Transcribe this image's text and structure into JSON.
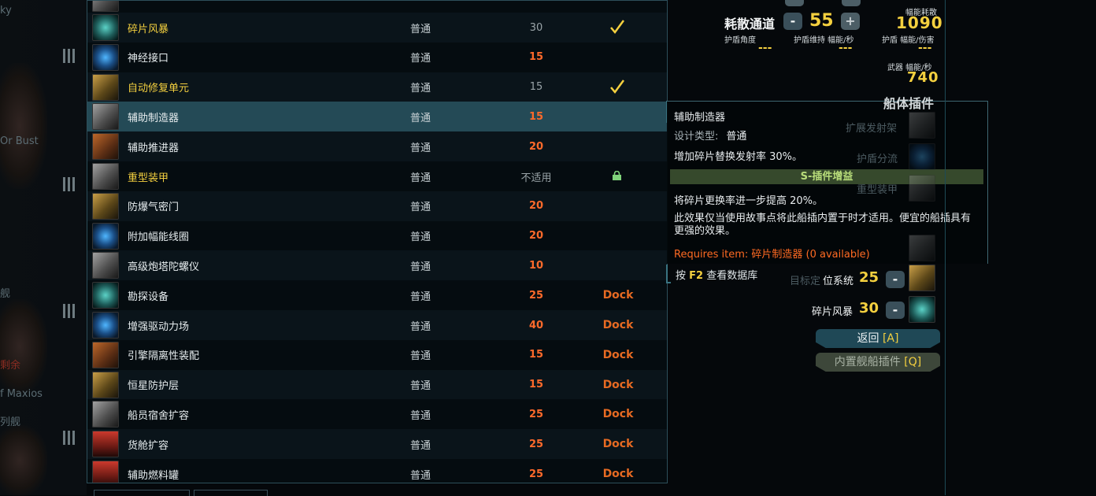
{
  "left_strip": {
    "frag1": "ky",
    "frag2": "Or Bust",
    "frag3": "舰",
    "frag4": "剩余",
    "frag5": "f Maxios",
    "frag6": "列舰"
  },
  "list": {
    "rows": [
      {
        "name": "碎片风暴",
        "type": "普通",
        "cost": "30",
        "status": "check",
        "highlight": true,
        "cost_style": "muted",
        "icon": "teal"
      },
      {
        "name": "神经接口",
        "type": "普通",
        "cost": "15",
        "status": "",
        "highlight": false,
        "cost_style": "orange",
        "icon": "blue"
      },
      {
        "name": "自动修复单元",
        "type": "普通",
        "cost": "15",
        "status": "check",
        "highlight": true,
        "cost_style": "muted",
        "icon": "gold"
      },
      {
        "name": "辅助制造器",
        "type": "普通",
        "cost": "15",
        "status": "",
        "highlight": false,
        "cost_style": "orange",
        "icon": "grey",
        "selected": true
      },
      {
        "name": "辅助推进器",
        "type": "普通",
        "cost": "20",
        "status": "",
        "highlight": false,
        "cost_style": "orange",
        "icon": "orange"
      },
      {
        "name": "重型装甲",
        "type": "普通",
        "cost": "不适用",
        "status": "lock",
        "highlight": true,
        "cost_style": "muted",
        "icon": "grey"
      },
      {
        "name": "防爆气密门",
        "type": "普通",
        "cost": "20",
        "status": "",
        "highlight": false,
        "cost_style": "orange",
        "icon": "gold"
      },
      {
        "name": "附加幅能线圈",
        "type": "普通",
        "cost": "20",
        "status": "",
        "highlight": false,
        "cost_style": "orange",
        "icon": "blue"
      },
      {
        "name": "高级炮塔陀螺仪",
        "type": "普通",
        "cost": "10",
        "status": "",
        "highlight": false,
        "cost_style": "orange",
        "icon": "grey"
      },
      {
        "name": "勘探设备",
        "type": "普通",
        "cost": "25",
        "status": "Dock",
        "highlight": false,
        "cost_style": "orange",
        "icon": "teal"
      },
      {
        "name": "增强驱动力场",
        "type": "普通",
        "cost": "40",
        "status": "Dock",
        "highlight": false,
        "cost_style": "orange",
        "icon": "blue"
      },
      {
        "name": "引擎隔离性装配",
        "type": "普通",
        "cost": "15",
        "status": "Dock",
        "highlight": false,
        "cost_style": "orange",
        "icon": "orange"
      },
      {
        "name": "恒星防护层",
        "type": "普通",
        "cost": "15",
        "status": "Dock",
        "highlight": false,
        "cost_style": "orange",
        "icon": "gold"
      },
      {
        "name": "船员宿舍扩容",
        "type": "普通",
        "cost": "25",
        "status": "Dock",
        "highlight": false,
        "cost_style": "orange",
        "icon": "grey"
      },
      {
        "name": "货舱扩容",
        "type": "普通",
        "cost": "25",
        "status": "Dock",
        "highlight": false,
        "cost_style": "orange",
        "icon": "red"
      },
      {
        "name": "辅助燃料罐",
        "type": "普通",
        "cost": "25",
        "status": "Dock",
        "highlight": false,
        "cost_style": "orange",
        "icon": "red"
      }
    ]
  },
  "tooltip": {
    "title": "辅助制造器",
    "type_label": "设计类型:",
    "type_value": "普通",
    "description": "增加碎片替换发射率 30%。",
    "smod_header": "S-插件增益",
    "smod_bonus": "将碎片更换率进一步提高 20%。",
    "smod_note": "此效果仅当使用故事点将此船插内置于时才适用。便宜的船插具有更强的效果。",
    "requires": "Requires item: 碎片制造器 (0 available)",
    "hint_prefix": "按",
    "hint_key": "F2",
    "hint_suffix": "查看数据库"
  },
  "stats": {
    "dissipation_label": "耗散通道",
    "minus": "-",
    "plus": "+",
    "dissipation_value": "55",
    "flux_label": "幅能耗散",
    "flux_value": "1090",
    "shield_arc_label": "护盾角度",
    "shield_upkeep_label": "护盾维持 幅能/秒",
    "shield_eff_label": "护盾 幅能/伤害",
    "shield_arc_value": "---",
    "shield_upkeep_value": "---",
    "shield_eff_value": "---",
    "weapon_label": "武器 幅能/秒",
    "weapon_value": "740",
    "hullmods_title": "船体插件"
  },
  "installed_mods": {
    "ghost1": "扩展发射架",
    "ghost2": "护盾分流",
    "ghost3": "重型装甲",
    "ghost4": "目标定",
    "row1_label": "位系统",
    "row1_value": "25",
    "row2_label": "碎片风暴",
    "row2_value": "30"
  },
  "actions": {
    "back_label": "返回",
    "back_key": "[A]",
    "build_label": "内置舰船插件",
    "build_key": "[Q]"
  }
}
